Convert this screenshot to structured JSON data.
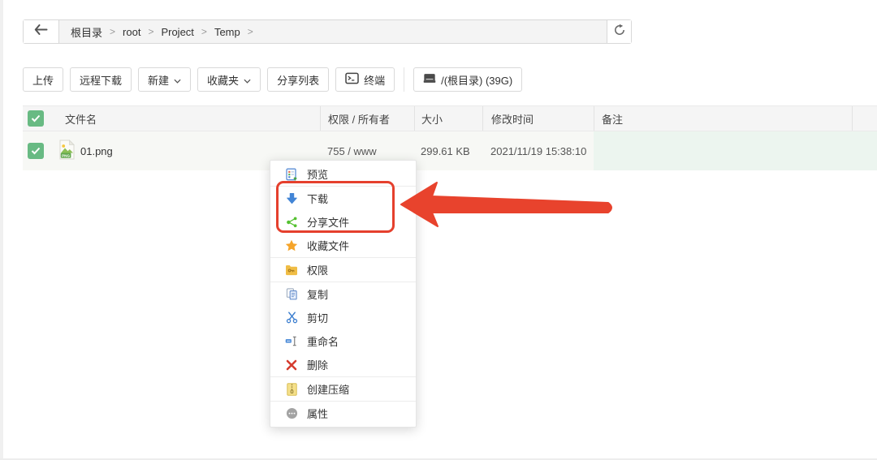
{
  "breadcrumb": {
    "items": [
      "根目录",
      "root",
      "Project",
      "Temp"
    ],
    "separator": ">"
  },
  "toolbar": {
    "upload": "上传",
    "remote_download": "远程下载",
    "new_item": "新建",
    "favorites": "收藏夹",
    "share_list": "分享列表",
    "terminal": "终端",
    "disk_root": "/(根目录) (39G)"
  },
  "file_table": {
    "columns": {
      "name": "文件名",
      "perm_owner": "权限 / 所有者",
      "size": "大小",
      "modified": "修改时间",
      "note": "备注"
    },
    "row": {
      "filename": "01.png",
      "file_type_badge": "PNG",
      "perm_owner": "755 / www",
      "size": "299.61 KB",
      "modified": "2021/11/19 15:38:10",
      "note": ""
    }
  },
  "context_menu": {
    "preview": "预览",
    "download": "下载",
    "share_file": "分享文件",
    "favorite_file": "收藏文件",
    "permission": "权限",
    "copy": "复制",
    "cut": "剪切",
    "rename": "重命名",
    "delete": "删除",
    "create_archive": "创建压缩",
    "properties": "属性"
  },
  "annotations": {
    "highlight_box_color": "#e5402d",
    "arrow_color": "#e8432d"
  },
  "colors": {
    "checkbox_green": "#68ba83",
    "header_bg": "#f5f5f5",
    "row_bg": "#f7f8f5",
    "row_note_bg": "#ecf5ef",
    "download_blue": "#4285d6",
    "share_green": "#55c131",
    "star_orange": "#f5a42a",
    "delete_red": "#d53c2f"
  }
}
